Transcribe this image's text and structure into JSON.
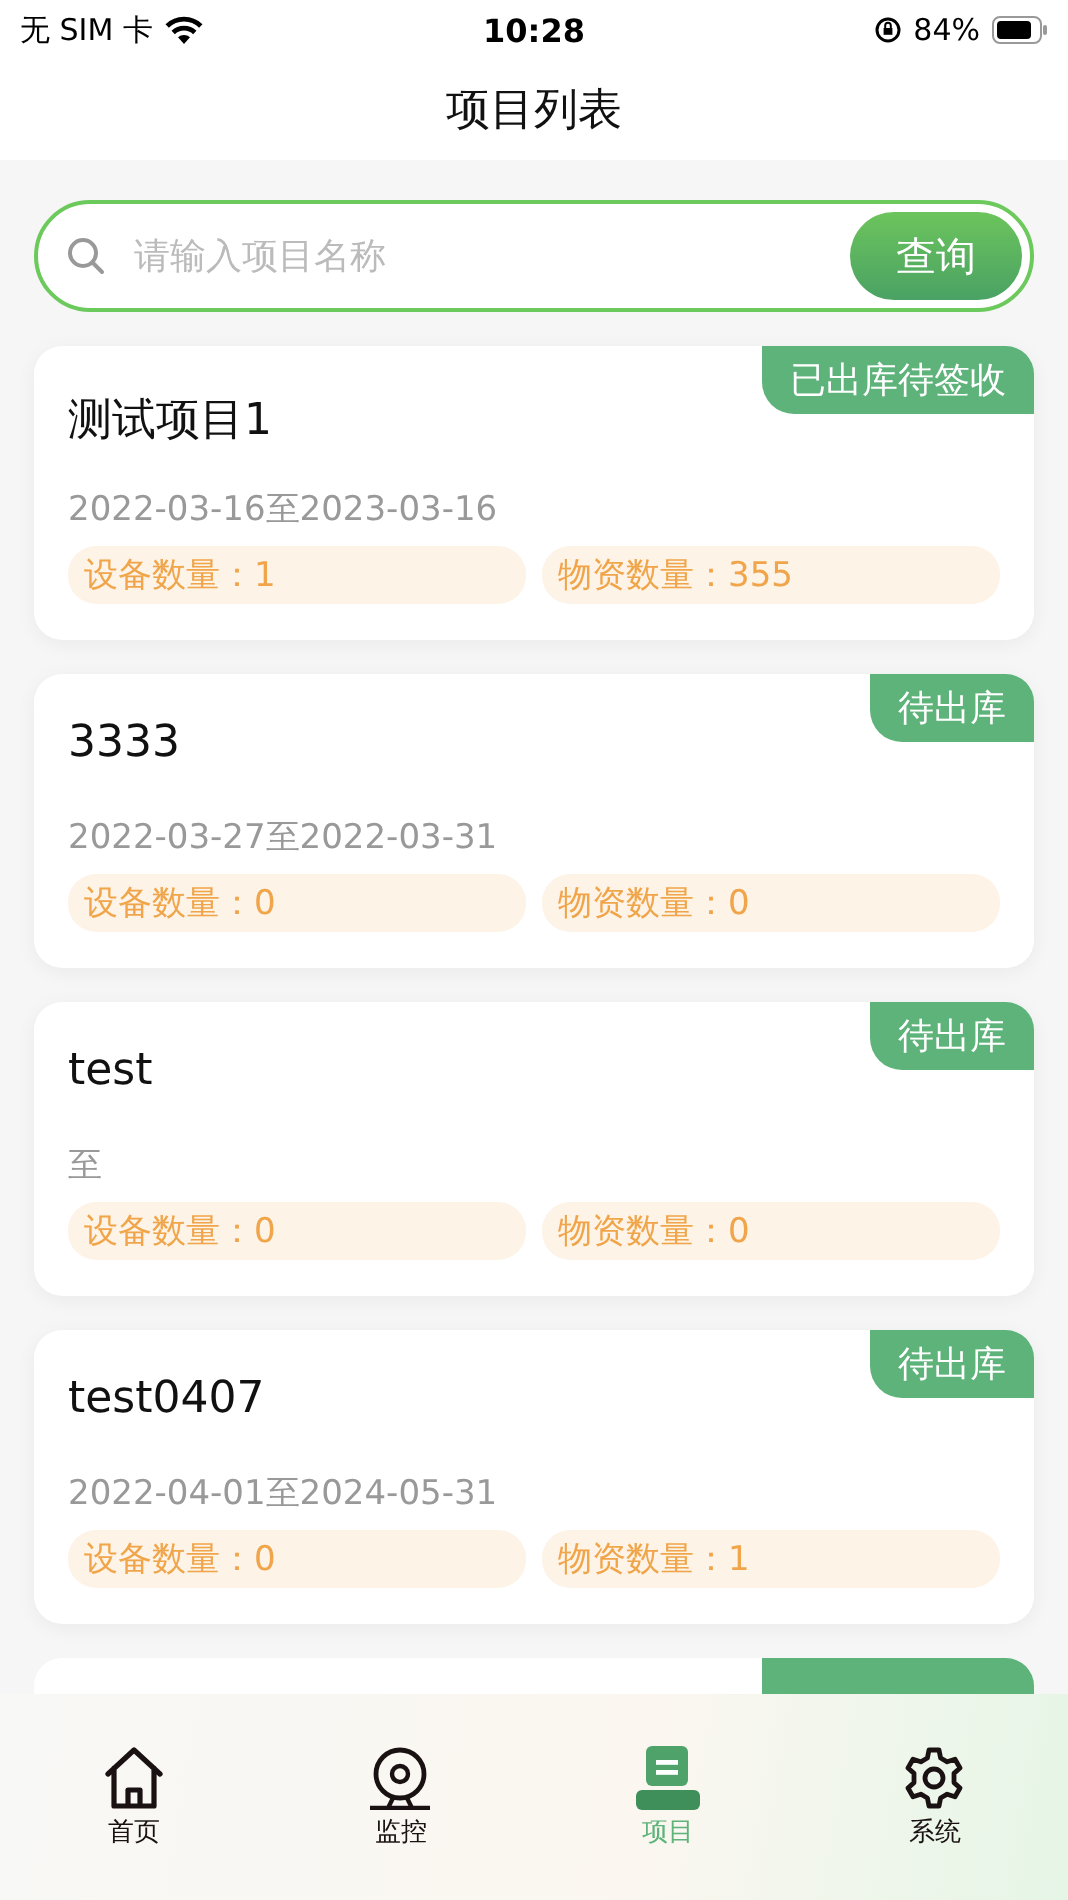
{
  "status_bar": {
    "carrier": "无 SIM 卡",
    "time": "10:28",
    "battery": "84%"
  },
  "title": "项目列表",
  "search": {
    "placeholder": "请输入项目名称",
    "button": "查询"
  },
  "projects": [
    {
      "name": "测试项目1",
      "status": "已出库待签收",
      "dates": "2022-03-16至2023-03-16",
      "devices": "设备数量：1",
      "materials": "物资数量：355"
    },
    {
      "name": "3333",
      "status": "待出库",
      "dates": "2022-03-27至2022-03-31",
      "devices": "设备数量：0",
      "materials": "物资数量：0"
    },
    {
      "name": "test",
      "status": "待出库",
      "dates": "至",
      "devices": "设备数量：0",
      "materials": "物资数量：0"
    },
    {
      "name": "test0407",
      "status": "待出库",
      "dates": "2022-04-01至2024-05-31",
      "devices": "设备数量：0",
      "materials": "物资数量：1"
    }
  ],
  "tabs": [
    {
      "label": "首页",
      "kind": "home",
      "selected": false
    },
    {
      "label": "监控",
      "kind": "camera",
      "selected": false
    },
    {
      "label": "项目",
      "kind": "project",
      "selected": true
    },
    {
      "label": "系统",
      "kind": "gear",
      "selected": false
    }
  ]
}
